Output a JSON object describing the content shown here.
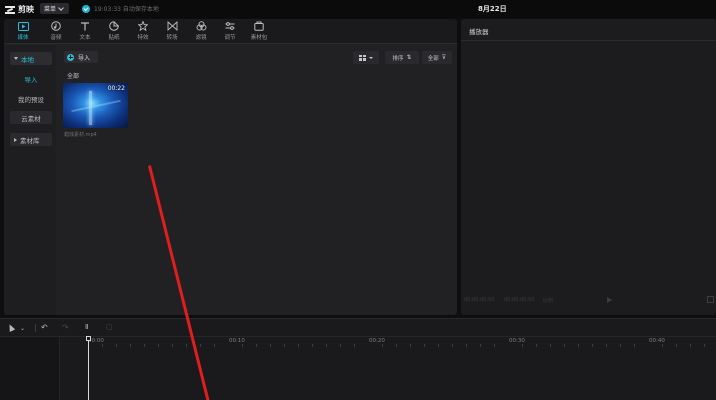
{
  "app": {
    "name": "剪映",
    "menu_label": "菜单",
    "autosave_text": "19:03:33 自动保存本地",
    "project_title": "8月22日"
  },
  "toolbar": {
    "items": [
      {
        "label": "媒体",
        "icon": "media-icon"
      },
      {
        "label": "音频",
        "icon": "audio-icon"
      },
      {
        "label": "文本",
        "icon": "text-icon"
      },
      {
        "label": "贴纸",
        "icon": "sticker-icon"
      },
      {
        "label": "特效",
        "icon": "effects-icon"
      },
      {
        "label": "转场",
        "icon": "transition-icon"
      },
      {
        "label": "滤镜",
        "icon": "filter-icon"
      },
      {
        "label": "调节",
        "icon": "adjust-icon"
      },
      {
        "label": "素材包",
        "icon": "asset-pack-icon"
      }
    ],
    "active": "媒体"
  },
  "side_nav": {
    "local_group": "本地",
    "import_item": "导入",
    "presets_item": "我的预设",
    "cloud_item": "云素材",
    "library_group": "素材库"
  },
  "media": {
    "import_label": "导入",
    "sort_label": "排序",
    "filter_label": "全部",
    "section_label": "全部",
    "clip": {
      "duration": "00:22",
      "filename": "蜡烛素材.mp4"
    }
  },
  "player": {
    "title": "播放器",
    "current_time": "00:00:00:00",
    "total_time": "00:00:00:00",
    "ratio_label": "比例"
  },
  "timeline": {
    "ruler_labels": [
      "00:00",
      "00:10",
      "00:20",
      "00:30",
      "00:40"
    ]
  },
  "colors": {
    "accent": "#25c2d8",
    "annotation": "#e01e1e"
  }
}
